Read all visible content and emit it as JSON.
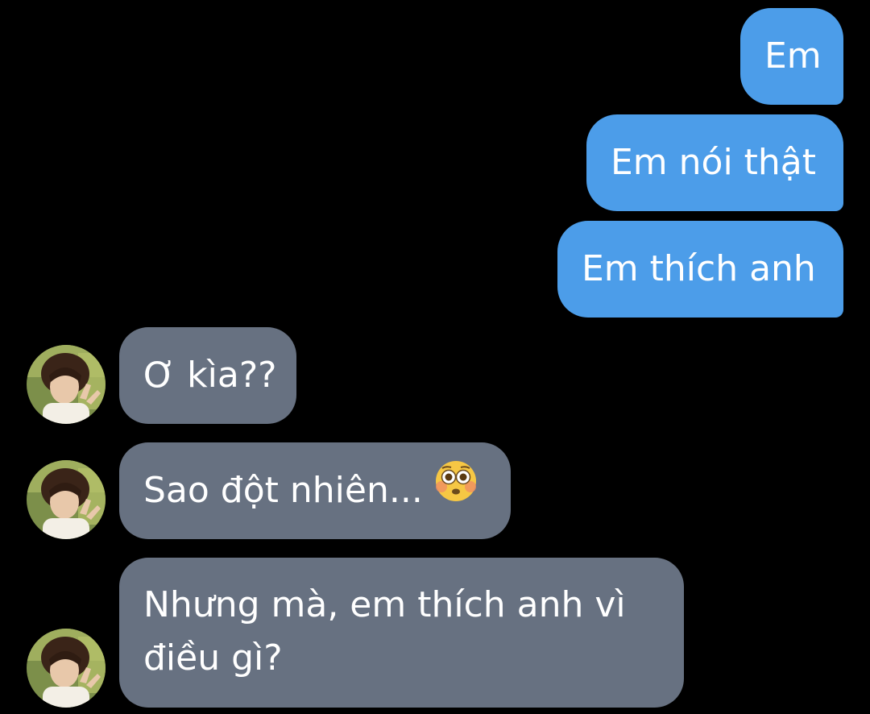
{
  "conversation": {
    "sent": [
      {
        "text": "Em"
      },
      {
        "text": "Em nói thật"
      },
      {
        "text": "Em thích anh"
      }
    ],
    "received": [
      {
        "text": "Ơ kìa??"
      },
      {
        "text": "Sao đột nhiên...",
        "emoji": "flushed-face-icon"
      },
      {
        "line1": "Nhưng mà, em thích anh vì",
        "line2": "điều gì?"
      }
    ]
  },
  "colors": {
    "background": "#000000",
    "sent_bubble": "#4c9de9",
    "received_bubble": "#677181",
    "text": "#ffffff"
  }
}
